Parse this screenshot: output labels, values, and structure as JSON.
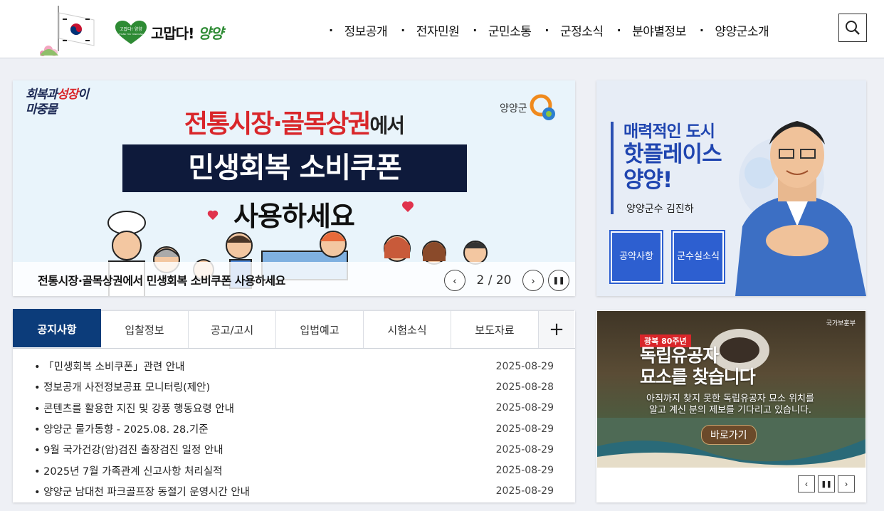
{
  "header": {
    "logo_prefix": "고맙다!",
    "logo_suffix": "양양",
    "logo_badge_line1": "고맙다! 양양",
    "logo_badge_line2": "THANK YOU YANGYANG",
    "nav": [
      "정보공개",
      "전자민원",
      "군민소통",
      "군정소식",
      "분야별정보",
      "양양군소개"
    ],
    "search_icon": "search-icon"
  },
  "banner": {
    "slogan_line1_a": "회복과",
    "slogan_line1_b": "성장",
    "slogan_line1_c": "이",
    "slogan_line2": "마중물",
    "county": "양양군",
    "headline_red": "전통시장·골목상권",
    "headline_black": "에서",
    "box_text": "민생회복 소비쿠폰",
    "sub_text": "사용하세요",
    "caption": "전통시장·골목상권에서 민생회복 소비쿠폰 사용하세요",
    "current_page": "2",
    "total_pages": "20",
    "page_separator": " / "
  },
  "promo": {
    "line1": "매력적인 도시",
    "line2": "핫플레이스",
    "line3": "양양!",
    "name": "양양군수 김진하",
    "btn1": "공약사항",
    "btn2_line1": "군수실",
    "btn2_line2": "소식"
  },
  "board": {
    "tabs": [
      "공지사항",
      "입찰정보",
      "공고/고시",
      "입법예고",
      "시험소식",
      "보도자료"
    ],
    "more_label": "+",
    "items": [
      {
        "title": "「민생회복 소비쿠폰」관련 안내",
        "date": "2025-08-29"
      },
      {
        "title": "정보공개 사전정보공표 모니터링(제안)",
        "date": "2025-08-28"
      },
      {
        "title": "콘텐츠를 활용한 지진 및 강풍 행동요령 안내",
        "date": "2025-08-29"
      },
      {
        "title": "양양군 물가동향 - 2025.08. 28.기준",
        "date": "2025-08-29"
      },
      {
        "title": "9월 국가건강(암)검진 출장검진 일정 안내",
        "date": "2025-08-29"
      },
      {
        "title": "2025년 7월 가족관계 신고사항 처리실적",
        "date": "2025-08-29"
      },
      {
        "title": "양양군 남대천 파크골프장 동절기 운영시간 안내",
        "date": "2025-08-29"
      }
    ]
  },
  "promo2": {
    "agency": "국가보훈부",
    "badge": "광복 80주년",
    "title_line1": "독립유공자",
    "title_line2": "묘소를 찾습니다",
    "desc_line1": "아직까지 찾지 못한 독립유공자 묘소 위치를",
    "desc_line2": "알고 계신 분의 제보를 기다리고 있습니다.",
    "button": "바로가기"
  },
  "colors": {
    "accent_navy": "#0c3c7a",
    "promo_blue": "#2d5fd0",
    "banner_red": "#d9262a",
    "logo_green": "#2e8b34"
  }
}
